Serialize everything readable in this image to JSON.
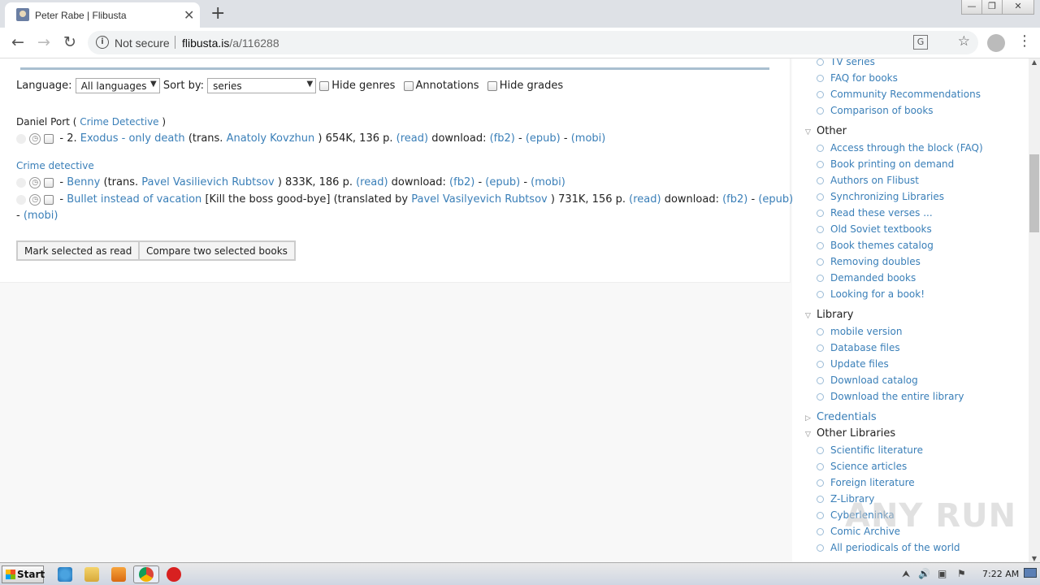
{
  "browser": {
    "tab_title": "Peter Rabe | Flibusta",
    "new_tab": "+",
    "close_tab": "✕",
    "security_label": "Not secure",
    "url_host": "flibusta.is",
    "url_path": "/a/116288"
  },
  "filters": {
    "language_label": "Language:",
    "language_value": "All languages",
    "sort_label": "Sort by:",
    "sort_value": "series",
    "hide_genres": "Hide genres",
    "annotations": "Annotations",
    "hide_grades": "Hide grades"
  },
  "series": {
    "name": "Daniel Port",
    "open_paren": "(",
    "genre": "Crime Detective",
    "close_paren": ")",
    "book": {
      "prefix": "- 2.",
      "title": "Exodus - only death",
      "trans_open": "(trans.",
      "translator": "Anatoly Kovzhun",
      "meta": ") 654K, 136 p.",
      "read": "(read)",
      "download_label": "download:",
      "fb2": "(fb2)",
      "epub": "(epub)",
      "mobi": "(mobi)",
      "dash": "-"
    }
  },
  "genre_group": {
    "title": "Crime detective",
    "books": [
      {
        "prefix": "-",
        "title": "Benny",
        "trans_open": "(trans.",
        "translator": "Pavel Vasilievich Rubtsov",
        "meta": ") 833K, 186 p.",
        "read": "(read)",
        "download_label": "download:",
        "fb2": "(fb2)",
        "epub": "(epub)",
        "mobi": "(mobi)"
      },
      {
        "prefix": "-",
        "title": "Bullet instead of vacation",
        "extra": "[Kill the boss good-bye] (translated by",
        "translator": "Pavel Vasilyevich Rubtsov",
        "meta": ") 731K, 156 p.",
        "read": "(read)",
        "download_label": "download:",
        "fb2": "(fb2)",
        "epub": "(epub)",
        "mobi": "(mobi)"
      }
    ]
  },
  "actions": {
    "mark_read": "Mark selected as read",
    "compare": "Compare two selected books"
  },
  "sidebar": {
    "top_items": [
      "TV series",
      "FAQ for books",
      "Community Recommendations",
      "Comparison of books"
    ],
    "other_title": "Other",
    "other_items": [
      "Access through the block (FAQ)",
      "Book printing on demand",
      "Authors on Flibust",
      "Synchronizing Libraries",
      "Read these verses ...",
      "Old Soviet textbooks",
      "Book themes catalog",
      "Removing doubles",
      "Demanded books",
      "Looking for a book!"
    ],
    "library_title": "Library",
    "library_items": [
      "mobile version",
      "Database files",
      "Update files",
      "Download catalog",
      "Download the entire library"
    ],
    "credentials_title": "Credentials",
    "other_libraries_title": "Other Libraries",
    "other_libraries_items": [
      "Scientific literature",
      "Science articles",
      "Foreign literature",
      "Z-Library",
      "Cyberleninka",
      "Comic Archive",
      "All periodicals of the world"
    ]
  },
  "taskbar": {
    "start": "Start",
    "time": "7:22 AM"
  },
  "watermark": "ANY RUN",
  "colors": {
    "link": "#3a7fb8",
    "tabstrip": "#dee1e6",
    "divider": "#a9bfd0"
  }
}
